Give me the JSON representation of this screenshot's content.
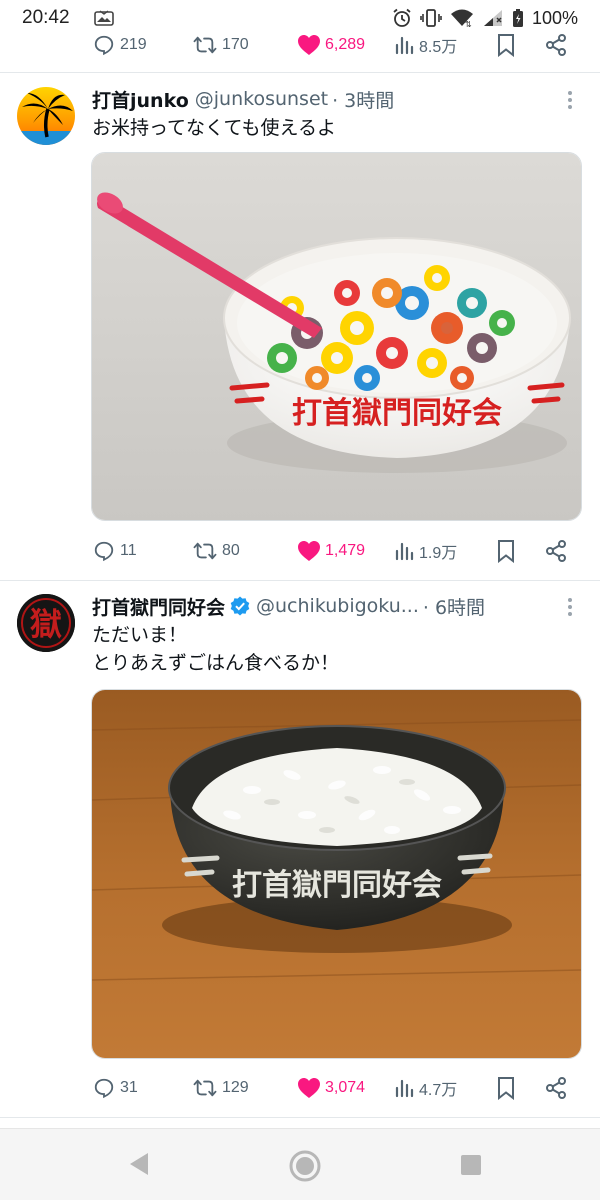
{
  "status_bar": {
    "time": "20:42",
    "battery": "100%",
    "icons": [
      "gallery-icon",
      "alarm-icon",
      "vibrate-icon",
      "wifi-icon",
      "signal-icon",
      "battery-icon"
    ]
  },
  "previous_tweet": {
    "replies": "219",
    "retweets": "170",
    "likes": "6,289",
    "views": "8.5万"
  },
  "tweets": [
    {
      "author_name": "打首junko",
      "handle": "@junkosunset",
      "time": "· 3時間",
      "text": "お米持ってなくても使えるよ",
      "media": "cereal-in-bowl-photo",
      "replies": "11",
      "retweets": "80",
      "likes": "1,479",
      "views": "1.9万"
    },
    {
      "author_name": "打首獄門同好会",
      "handle": "@uchikubigoku...",
      "time": "· 6時間",
      "verified": true,
      "text": "ただいま！\nとりあえずごはん食べるか！",
      "media": "rice-in-bowl-photo",
      "replies": "31",
      "retweets": "129",
      "likes": "3,074",
      "views": "4.7万"
    }
  ],
  "media_text": {
    "bowl_print_1": "打首獄門同好会",
    "bowl_print_2": "打首獄門同好会",
    "avatar_glyph": "獄"
  },
  "colors": {
    "like": "#f91880",
    "secondary_text": "#536471",
    "verified": "#1d9bf0"
  },
  "nav_bar": {
    "icons": [
      "back-icon",
      "home-icon",
      "recents-icon"
    ]
  }
}
